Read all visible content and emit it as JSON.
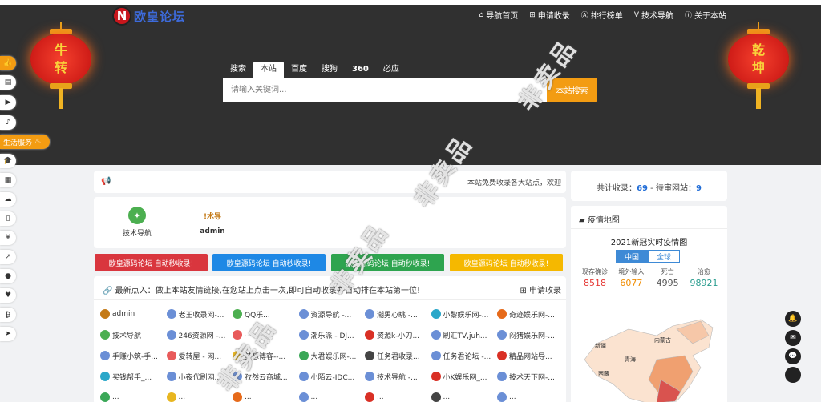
{
  "site": {
    "logo_mark": "N",
    "logo_name": "欧皇论坛"
  },
  "nav": [
    {
      "icon": "home-icon",
      "glyph": "⌂",
      "label": "导航首页"
    },
    {
      "icon": "plus-square-icon",
      "glyph": "⊞",
      "label": "申请收录"
    },
    {
      "icon": "ranking-icon",
      "glyph": "Ⓐ",
      "label": "排行榜单"
    },
    {
      "icon": "v-icon",
      "glyph": "V",
      "label": "技术导航"
    },
    {
      "icon": "info-icon",
      "glyph": "ⓘ",
      "label": "关于本站"
    }
  ],
  "lanterns": {
    "left": [
      "牛",
      "转"
    ],
    "right": [
      "乾",
      "坤"
    ]
  },
  "sidebar": {
    "items": [
      {
        "icon": "thumbs-up-icon",
        "glyph": "👍"
      },
      {
        "icon": "printer-icon",
        "glyph": "▤"
      },
      {
        "icon": "video-icon",
        "glyph": "▶"
      },
      {
        "icon": "music-icon",
        "glyph": "♪"
      },
      {
        "icon": "life-service-icon",
        "glyph": "♨",
        "label": "生活服务"
      },
      {
        "icon": "graduation-cap-icon",
        "glyph": "🎓"
      },
      {
        "icon": "grid-icon",
        "glyph": "▦"
      },
      {
        "icon": "cloud-icon",
        "glyph": "☁"
      },
      {
        "icon": "file-icon",
        "glyph": "▯"
      },
      {
        "icon": "yen-icon",
        "glyph": "¥"
      },
      {
        "icon": "chart-icon",
        "glyph": "↗"
      },
      {
        "icon": "circle-icon",
        "glyph": "●"
      },
      {
        "icon": "heartbeat-icon",
        "glyph": "♥"
      },
      {
        "icon": "bitcoin-icon",
        "glyph": "₿"
      },
      {
        "icon": "paper-plane-icon",
        "glyph": "➤"
      }
    ]
  },
  "search": {
    "tabs": [
      "搜索",
      "本站",
      "百度",
      "搜狗",
      "360",
      "必应"
    ],
    "active_tab": "本站",
    "placeholder": "请输入关键词...",
    "button": "本站搜索"
  },
  "notice": {
    "text": "本站免费收录各大站点，欢迎"
  },
  "quick": [
    {
      "icon": "compass-icon",
      "label": "技术导航"
    },
    {
      "icon": "admin-logo-icon",
      "logo_text": "!术导",
      "label": "admin"
    }
  ],
  "banners": [
    {
      "text": "欧皇源码论坛 自动秒收录!",
      "color": "#d9363e"
    },
    {
      "text": "欧皇源码论坛 自动秒收录!",
      "color": "#1e88e5"
    },
    {
      "text": "欧皇源码论坛 自动秒收录!",
      "color": "#2ea44f"
    },
    {
      "text": "欧皇源码论坛 自动秒收录!",
      "color": "#f5b800"
    }
  ],
  "links": {
    "header": "最新点入：做上本站友情链接,在您站上点击一次,即可自动收录并自动排在本站第一位!",
    "apply": "申请收录",
    "items": [
      "admin",
      "老王收录网-...",
      "QQ乐...",
      "资源导航 -...",
      "潮男心眺 -...",
      "小黎娱乐网-...",
      "奇迹娱乐网-...",
      "技术导航",
      "246资源网 -...",
      "...",
      "潮乐派 - DJ...",
      "资源k-小刀...",
      "刷汇TV,juh...",
      "闷猪娱乐网-...",
      "手赚小筑-手...",
      "爱转屋 - 网...",
      "梦想博客--...",
      "大君娱乐网-...",
      "任务君收录...",
      "任务君论坛 -...",
      "精品网站导...",
      "买钱帮手_...",
      "小夜代刷网...",
      "孜然云商城...",
      "小陌云-IDC...",
      "技术导航 -...",
      "小K娱乐网_...",
      "技术天下网-...",
      "...",
      "...",
      "...",
      "...",
      "...",
      "...",
      "..."
    ],
    "colors": [
      "#c47a17",
      "#6b8fd6",
      "#4caf50",
      "#6b8fd6",
      "#6b8fd6",
      "#2aa7c9",
      "#e66a1a",
      "#4caf50",
      "#6b8fd6",
      "#e85a5a",
      "#6b8fd6",
      "#d93025",
      "#6b8fd6",
      "#6b8fd6",
      "#6b8fd6",
      "#e85a5a",
      "#e8b620",
      "#3aa757",
      "#444444",
      "#6b8fd6",
      "#d93025",
      "#2aa7c9",
      "#6b8fd6",
      "#6b8fd6",
      "#6b8fd6",
      "#6b8fd6",
      "#d93025",
      "#6b8fd6",
      "#3aa757",
      "#e8b620",
      "#e66a1a",
      "#6b8fd6",
      "#d93025",
      "#444444",
      "#6b8fd6"
    ]
  },
  "stats": {
    "total_label": "共计收录：",
    "total": "69",
    "sep": " - 待审网站：",
    "pending": "9"
  },
  "epidemic": {
    "header": "疫情地图",
    "title": "2021新冠实时疫情图",
    "tabs": [
      "中国",
      "全球"
    ],
    "active_tab": "中国",
    "columns": [
      {
        "label": "现存确诊",
        "value": "8518",
        "color": "#e53935"
      },
      {
        "label": "境外输入",
        "value": "6077",
        "color": "#f08c00"
      },
      {
        "label": "死亡",
        "value": "4995",
        "color": "#555555"
      },
      {
        "label": "治愈",
        "value": "98921",
        "color": "#2a9d8f"
      }
    ],
    "map_labels": [
      "新疆",
      "内蒙古",
      "西藏",
      "青海"
    ]
  },
  "float_buttons": [
    "bell-icon",
    "mail-icon",
    "wechat-icon",
    "top-icon"
  ],
  "watermark": "非卖品"
}
